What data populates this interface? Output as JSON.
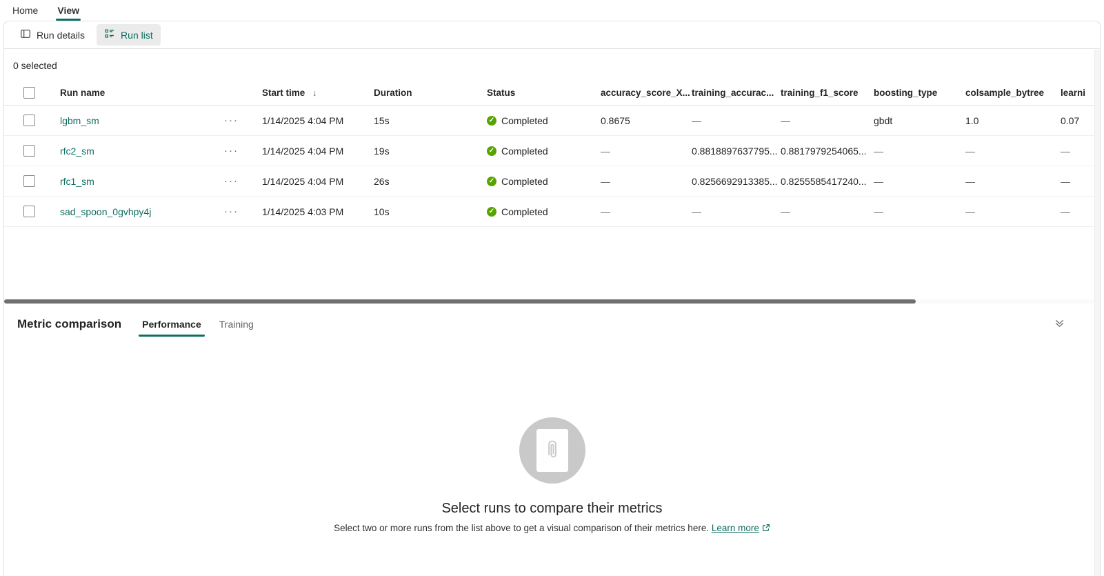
{
  "accent_color": "#0d6e61",
  "status_green_color": "#57a300",
  "icons": {
    "check": "✓",
    "sort_desc": "↓",
    "more": "···"
  },
  "ribbon": {
    "tabs": [
      {
        "label": "Home",
        "active": false
      },
      {
        "label": "View",
        "active": true
      }
    ]
  },
  "toolbar": {
    "run_details_label": "Run details",
    "run_list_label": "Run list"
  },
  "table": {
    "selection_status": "0 selected",
    "headers": {
      "run_name": "Run name",
      "start_time": "Start time",
      "duration": "Duration",
      "status": "Status",
      "accuracy_score": "accuracy_score_X...",
      "training_accuracy": "training_accurac...",
      "training_f1_score": "training_f1_score",
      "boosting_type": "boosting_type",
      "colsample_bytree": "colsample_bytree",
      "learning_rate": "learni"
    },
    "rows": [
      {
        "name": "lgbm_sm",
        "start_time": "1/14/2025 4:04 PM",
        "duration": "15s",
        "status": "Completed",
        "accuracy_score": "0.8675",
        "training_accuracy": "—",
        "training_f1_score": "—",
        "boosting_type": "gbdt",
        "colsample_bytree": "1.0",
        "learning_rate": "0.07"
      },
      {
        "name": "rfc2_sm",
        "start_time": "1/14/2025 4:04 PM",
        "duration": "19s",
        "status": "Completed",
        "accuracy_score": "—",
        "training_accuracy": "0.8818897637795...",
        "training_f1_score": "0.8817979254065...",
        "boosting_type": "—",
        "colsample_bytree": "—",
        "learning_rate": "—"
      },
      {
        "name": "rfc1_sm",
        "start_time": "1/14/2025 4:04 PM",
        "duration": "26s",
        "status": "Completed",
        "accuracy_score": "—",
        "training_accuracy": "0.8256692913385...",
        "training_f1_score": "0.8255585417240...",
        "boosting_type": "—",
        "colsample_bytree": "—",
        "learning_rate": "—"
      },
      {
        "name": "sad_spoon_0gvhpy4j",
        "start_time": "1/14/2025 4:03 PM",
        "duration": "10s",
        "status": "Completed",
        "accuracy_score": "—",
        "training_accuracy": "—",
        "training_f1_score": "—",
        "boosting_type": "—",
        "colsample_bytree": "—",
        "learning_rate": "—"
      }
    ]
  },
  "metric_panel": {
    "title": "Metric comparison",
    "tabs": [
      {
        "label": "Performance",
        "active": true
      },
      {
        "label": "Training",
        "active": false
      }
    ],
    "empty_state": {
      "heading": "Select runs to compare their metrics",
      "description": "Select two or more runs from the list above to get a visual comparison of their metrics here.",
      "learn_more_label": "Learn more"
    }
  }
}
